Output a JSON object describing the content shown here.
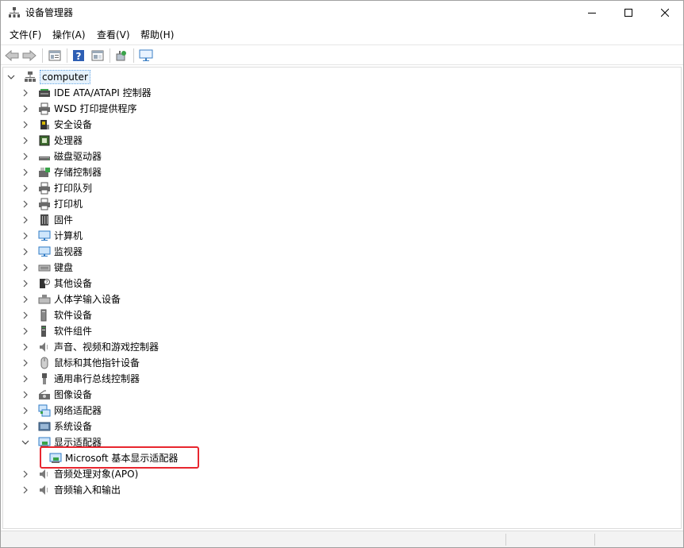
{
  "window": {
    "title": "设备管理器",
    "min_glyph": "—",
    "max_glyph": "☐",
    "close_glyph": "✕"
  },
  "menu": {
    "items": [
      {
        "label": "文件(F)"
      },
      {
        "label": "操作(A)"
      },
      {
        "label": "查看(V)"
      },
      {
        "label": "帮助(H)"
      }
    ]
  },
  "toolbar": {
    "buttons": [
      "back-icon",
      "forward-icon",
      "properties-icon",
      "help-icon",
      "console-icon",
      "scan-icon",
      "monitor-icon"
    ]
  },
  "tree": {
    "root": {
      "label": "computer",
      "expanded": true
    },
    "items": [
      {
        "label": "IDE ATA/ATAPI 控制器",
        "icon": "ide-controller-icon",
        "expanded": false
      },
      {
        "label": "WSD 打印提供程序",
        "icon": "printer-icon",
        "expanded": false
      },
      {
        "label": "安全设备",
        "icon": "security-device-icon",
        "expanded": false
      },
      {
        "label": "处理器",
        "icon": "processor-icon",
        "expanded": false
      },
      {
        "label": "磁盘驱动器",
        "icon": "disk-drive-icon",
        "expanded": false
      },
      {
        "label": "存储控制器",
        "icon": "storage-controller-icon",
        "expanded": false
      },
      {
        "label": "打印队列",
        "icon": "print-queue-icon",
        "expanded": false
      },
      {
        "label": "打印机",
        "icon": "printer-icon",
        "expanded": false
      },
      {
        "label": "固件",
        "icon": "firmware-icon",
        "expanded": false
      },
      {
        "label": "计算机",
        "icon": "computer-icon",
        "expanded": false
      },
      {
        "label": "监视器",
        "icon": "monitor-icon",
        "expanded": false
      },
      {
        "label": "键盘",
        "icon": "keyboard-icon",
        "expanded": false
      },
      {
        "label": "其他设备",
        "icon": "other-devices-icon",
        "expanded": false
      },
      {
        "label": "人体学输入设备",
        "icon": "hid-icon",
        "expanded": false
      },
      {
        "label": "软件设备",
        "icon": "software-device-icon",
        "expanded": false
      },
      {
        "label": "软件组件",
        "icon": "software-component-icon",
        "expanded": false
      },
      {
        "label": "声音、视频和游戏控制器",
        "icon": "sound-icon",
        "expanded": false
      },
      {
        "label": "鼠标和其他指针设备",
        "icon": "mouse-icon",
        "expanded": false
      },
      {
        "label": "通用串行总线控制器",
        "icon": "usb-icon",
        "expanded": false
      },
      {
        "label": "图像设备",
        "icon": "camera-icon",
        "expanded": false
      },
      {
        "label": "网络适配器",
        "icon": "network-adapter-icon",
        "expanded": false
      },
      {
        "label": "系统设备",
        "icon": "system-device-icon",
        "expanded": false
      },
      {
        "label": "显示适配器",
        "icon": "display-adapter-icon",
        "expanded": true,
        "children": [
          {
            "label": "Microsoft 基本显示适配器",
            "icon": "display-adapter-icon"
          }
        ]
      },
      {
        "label": "音频处理对象(APO)",
        "icon": "audio-icon",
        "expanded": false
      },
      {
        "label": "音频输入和输出",
        "icon": "audio-icon",
        "expanded": false
      }
    ]
  },
  "colors": {
    "highlight": "#e8262f",
    "selection": "#e5f1fb"
  }
}
